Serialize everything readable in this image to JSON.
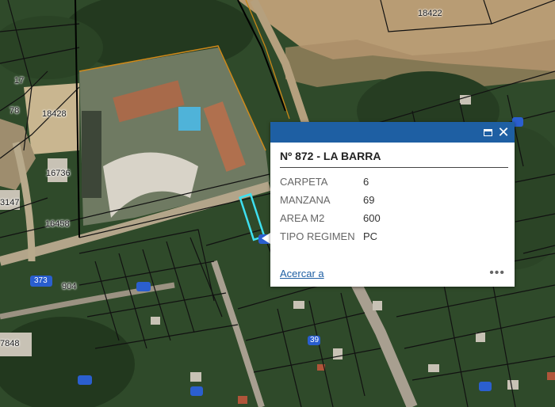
{
  "map": {
    "parcel_labels": [
      "18422",
      "18428",
      "16736",
      "16458",
      "3147",
      "373",
      "904",
      "7848",
      "78",
      "17"
    ],
    "route_labels": [
      "373",
      "39"
    ]
  },
  "popup": {
    "title": "Nº 872 - LA BARRA",
    "attributes": [
      {
        "key": "CARPETA",
        "value": "6"
      },
      {
        "key": "MANZANA",
        "value": "69"
      },
      {
        "key": "AREA M2",
        "value": "600"
      },
      {
        "key": "TIPO REGIMEN",
        "value": "PC"
      }
    ],
    "zoom_label": "Acercar a",
    "more_label": "•••",
    "maximize_icon": "maximize-icon",
    "close_icon": "close-icon",
    "header_color": "#1e5fa3"
  }
}
